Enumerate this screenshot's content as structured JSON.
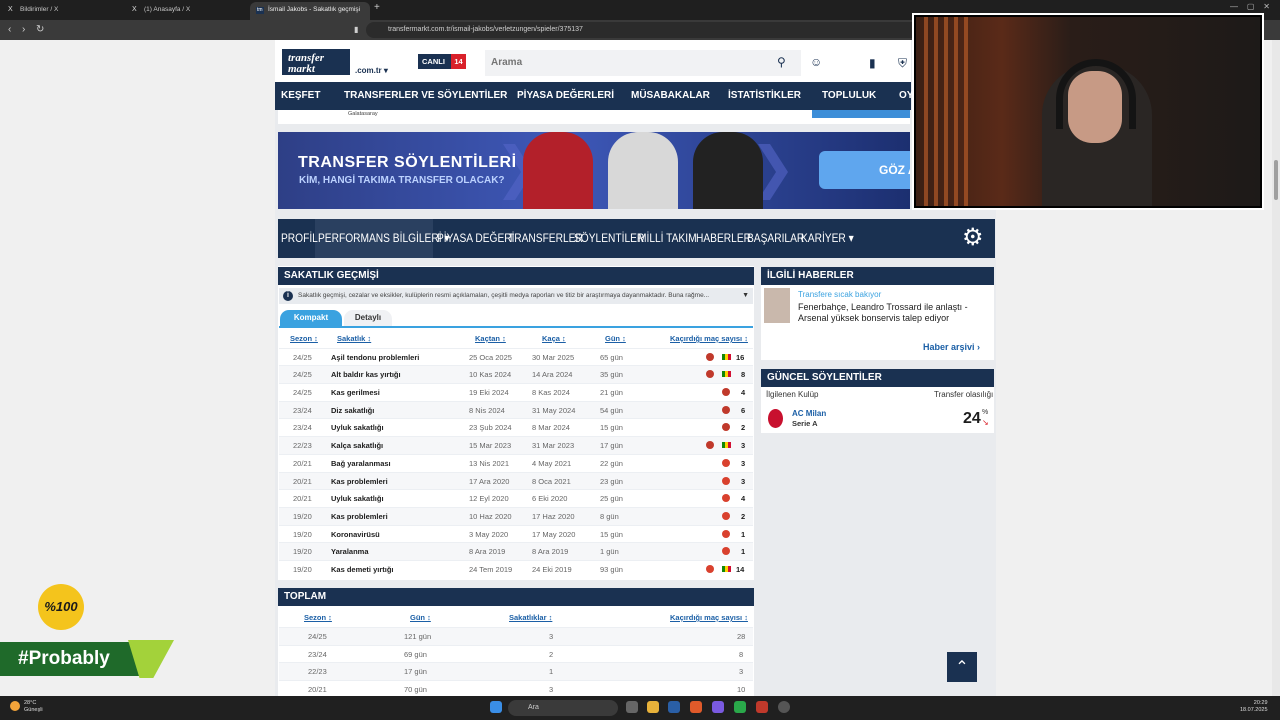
{
  "browser": {
    "tabs": [
      {
        "label": "Bildirimler / X",
        "icon": "X"
      },
      {
        "label": "(1) Anasayfa / X",
        "icon": "X"
      },
      {
        "label": "İsmail Jakobs - Sakatlık geçmişi",
        "icon": "tm"
      }
    ],
    "url": "transfermarkt.com.tr/ismail-jakobs/verletzungen/spieler/375137"
  },
  "site": {
    "domain_suffix": ".com.tr",
    "logo_line1": "transfer",
    "logo_line2": "markt",
    "live_label": "CANLI",
    "live_count": "14",
    "search_placeholder": "Arama",
    "nav": [
      "KEŞFET",
      "TRANSFERLER VE SÖYLENTİLER",
      "PİYASA DEĞERLERİ",
      "MÜSABAKALAR",
      "İSTATİSTİKLER",
      "TOPLULUK",
      "OY"
    ],
    "strip_club": "Galatasaray"
  },
  "banner": {
    "title": "TRANSFER SÖYLENTİLERİ",
    "subtitle": "KİM, HANGİ TAKIMA TRANSFER OLACAK?",
    "cta": "GÖZ A"
  },
  "profile_nav": [
    "PROFİL",
    "PERFORMANS BİLGİLERİ ▾",
    "PİYASA DEĞERİ",
    "TRANSFERLER",
    "SÖYLENTİLER",
    "MİLLİ TAKIM",
    "HABERLER",
    "BAŞARILAR",
    "KARİYER ▾"
  ],
  "injury": {
    "title": "SAKATLIK GEÇMİŞİ",
    "info": "Sakatlık geçmişi, cezalar ve eksikler, kulüplerin resmi açıklamaları, çeşitli medya raporları ve titiz bir araştırmaya dayanmaktadır. Buna rağme...",
    "tab_compact": "Kompakt",
    "tab_detail": "Detaylı",
    "headers": [
      "Sezon ↕",
      "Sakatlık ↕",
      "Kaçtan ↕",
      "Kaça ↕",
      "Gün ↕",
      "Kaçırdığı maç sayısı ↕"
    ],
    "rows": [
      {
        "season": "24/25",
        "injury": "Aşil tendonu problemleri",
        "from": "25 Oca 2025",
        "until": "30 Mar 2025",
        "days": "65 gün",
        "games": "16",
        "flag": true,
        "club": "#c0392b"
      },
      {
        "season": "24/25",
        "injury": "Alt baldır kas yırtığı",
        "from": "10 Kas 2024",
        "until": "14 Ara 2024",
        "days": "35 gün",
        "games": "8",
        "flag": true,
        "club": "#c0392b"
      },
      {
        "season": "24/25",
        "injury": "Kas gerilmesi",
        "from": "19 Eki 2024",
        "until": "8 Kas 2024",
        "days": "21 gün",
        "games": "4",
        "flag": false,
        "club": "#c0392b"
      },
      {
        "season": "23/24",
        "injury": "Diz sakatlığı",
        "from": "8 Nis 2024",
        "until": "31 May 2024",
        "days": "54 gün",
        "games": "6",
        "flag": false,
        "club": "#c0392b"
      },
      {
        "season": "23/24",
        "injury": "Uyluk sakatlığı",
        "from": "23 Şub 2024",
        "until": "8 Mar 2024",
        "days": "15 gün",
        "games": "2",
        "flag": false,
        "club": "#c0392b"
      },
      {
        "season": "22/23",
        "injury": "Kalça sakatlığı",
        "from": "15 Mar 2023",
        "until": "31 Mar 2023",
        "days": "17 gün",
        "games": "3",
        "flag": true,
        "club": "#c0392b"
      },
      {
        "season": "20/21",
        "injury": "Bağ yaralanması",
        "from": "13 Nis 2021",
        "until": "4 May 2021",
        "days": "22 gün",
        "games": "3",
        "flag": false,
        "club": "#d9412e"
      },
      {
        "season": "20/21",
        "injury": "Kas problemleri",
        "from": "17 Ara 2020",
        "until": "8 Oca 2021",
        "days": "23 gün",
        "games": "3",
        "flag": false,
        "club": "#d9412e"
      },
      {
        "season": "20/21",
        "injury": "Uyluk sakatlığı",
        "from": "12 Eyl 2020",
        "until": "6 Eki 2020",
        "days": "25 gün",
        "games": "4",
        "flag": false,
        "club": "#d9412e"
      },
      {
        "season": "19/20",
        "injury": "Kas problemleri",
        "from": "10 Haz 2020",
        "until": "17 Haz 2020",
        "days": "8 gün",
        "games": "2",
        "flag": false,
        "club": "#d9412e"
      },
      {
        "season": "19/20",
        "injury": "Koronavirüsü",
        "from": "3 May 2020",
        "until": "17 May 2020",
        "days": "15 gün",
        "games": "1",
        "flag": false,
        "club": "#d9412e"
      },
      {
        "season": "19/20",
        "injury": "Yaralanma",
        "from": "8 Ara 2019",
        "until": "8 Ara 2019",
        "days": "1 gün",
        "games": "1",
        "flag": false,
        "club": "#d9412e"
      },
      {
        "season": "19/20",
        "injury": "Kas demeti yırtığı",
        "from": "24 Tem 2019",
        "until": "24 Eki 2019",
        "days": "93 gün",
        "games": "14",
        "flag": true,
        "club": "#d9412e"
      }
    ]
  },
  "totals": {
    "title": "TOPLAM",
    "headers": [
      "Sezon ↕",
      "Gün ↕",
      "Sakatlıklar ↕",
      "Kaçırdığı maç sayısı ↕"
    ],
    "rows": [
      {
        "season": "24/25",
        "days": "121 gün",
        "injuries": "3",
        "games": "28"
      },
      {
        "season": "23/24",
        "days": "69 gün",
        "injuries": "2",
        "games": "8"
      },
      {
        "season": "22/23",
        "days": "17 gün",
        "injuries": "1",
        "games": "3"
      },
      {
        "season": "20/21",
        "days": "70 gün",
        "injuries": "3",
        "games": "10"
      }
    ]
  },
  "sidebar": {
    "news_title": "İLGİLİ HABERLER",
    "news_link": "Transfere sıcak bakıyor",
    "news_headline": "Fenerbahçe, Leandro Trossard ile anlaştı - Arsenal yüksek bonservis talep ediyor",
    "news_archive": "Haber arşivi",
    "rumors_title": "GÜNCEL SÖYLENTİLER",
    "rumors_col1": "İlgilenen Kulüp",
    "rumors_col2": "Transfer olasılığı",
    "rumor_club": "AC Milan",
    "rumor_league": "Serie A",
    "rumor_pct": "24",
    "rumor_pct_unit": "%"
  },
  "overlays": {
    "badge": "%100",
    "hashtag": "#Probably"
  },
  "taskbar": {
    "temp": "28°C",
    "weather": "Güneşli",
    "search": "Ara",
    "time": "20:29",
    "date": "18.07.2025"
  },
  "colors": {
    "navy": "#1a3151",
    "accent": "#3aa2e0",
    "live_red": "#d9212a"
  }
}
